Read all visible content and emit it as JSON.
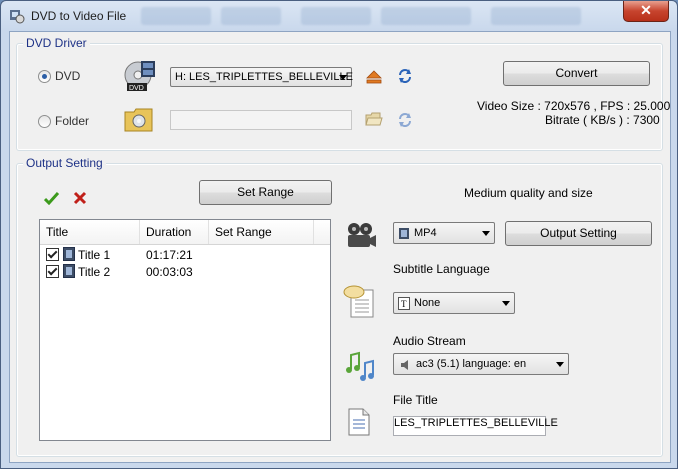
{
  "window": {
    "title": "DVD to Video File",
    "close_glyph": "✕"
  },
  "dvd_driver": {
    "group_title": "DVD Driver",
    "dvd_radio_label": "DVD",
    "folder_radio_label": "Folder",
    "drive_select_value": "H:  LES_TRIPLETTES_BELLEVILLE",
    "folder_path_value": "",
    "convert_label": "Convert",
    "video_info": "Video Size : 720x576 , FPS : 25.000",
    "bitrate_info": "Bitrate ( KB/s ) : 7300"
  },
  "output": {
    "group_title": "Output Setting",
    "set_range_label": "Set Range",
    "quality_text": "Medium quality and size",
    "columns": [
      "Title",
      "Duration",
      "Set Range"
    ],
    "titles": [
      {
        "name": "Title 1",
        "duration": "01:17:21",
        "range": ""
      },
      {
        "name": "Title 2",
        "duration": "00:03:03",
        "range": ""
      }
    ],
    "format_value": "MP4",
    "output_setting_label": "Output Setting",
    "subtitle_label": "Subtitle Language",
    "subtitle_value": "None",
    "audio_label": "Audio Stream",
    "audio_value": "ac3 (5.1) language: en",
    "file_title_label": "File Title",
    "file_title_value": "LES_TRIPLETTES_BELLEVILLE"
  },
  "colors": {
    "accent_title": "#1e3287",
    "check_green": "#3c9a1c",
    "cross_red": "#c0201a"
  }
}
